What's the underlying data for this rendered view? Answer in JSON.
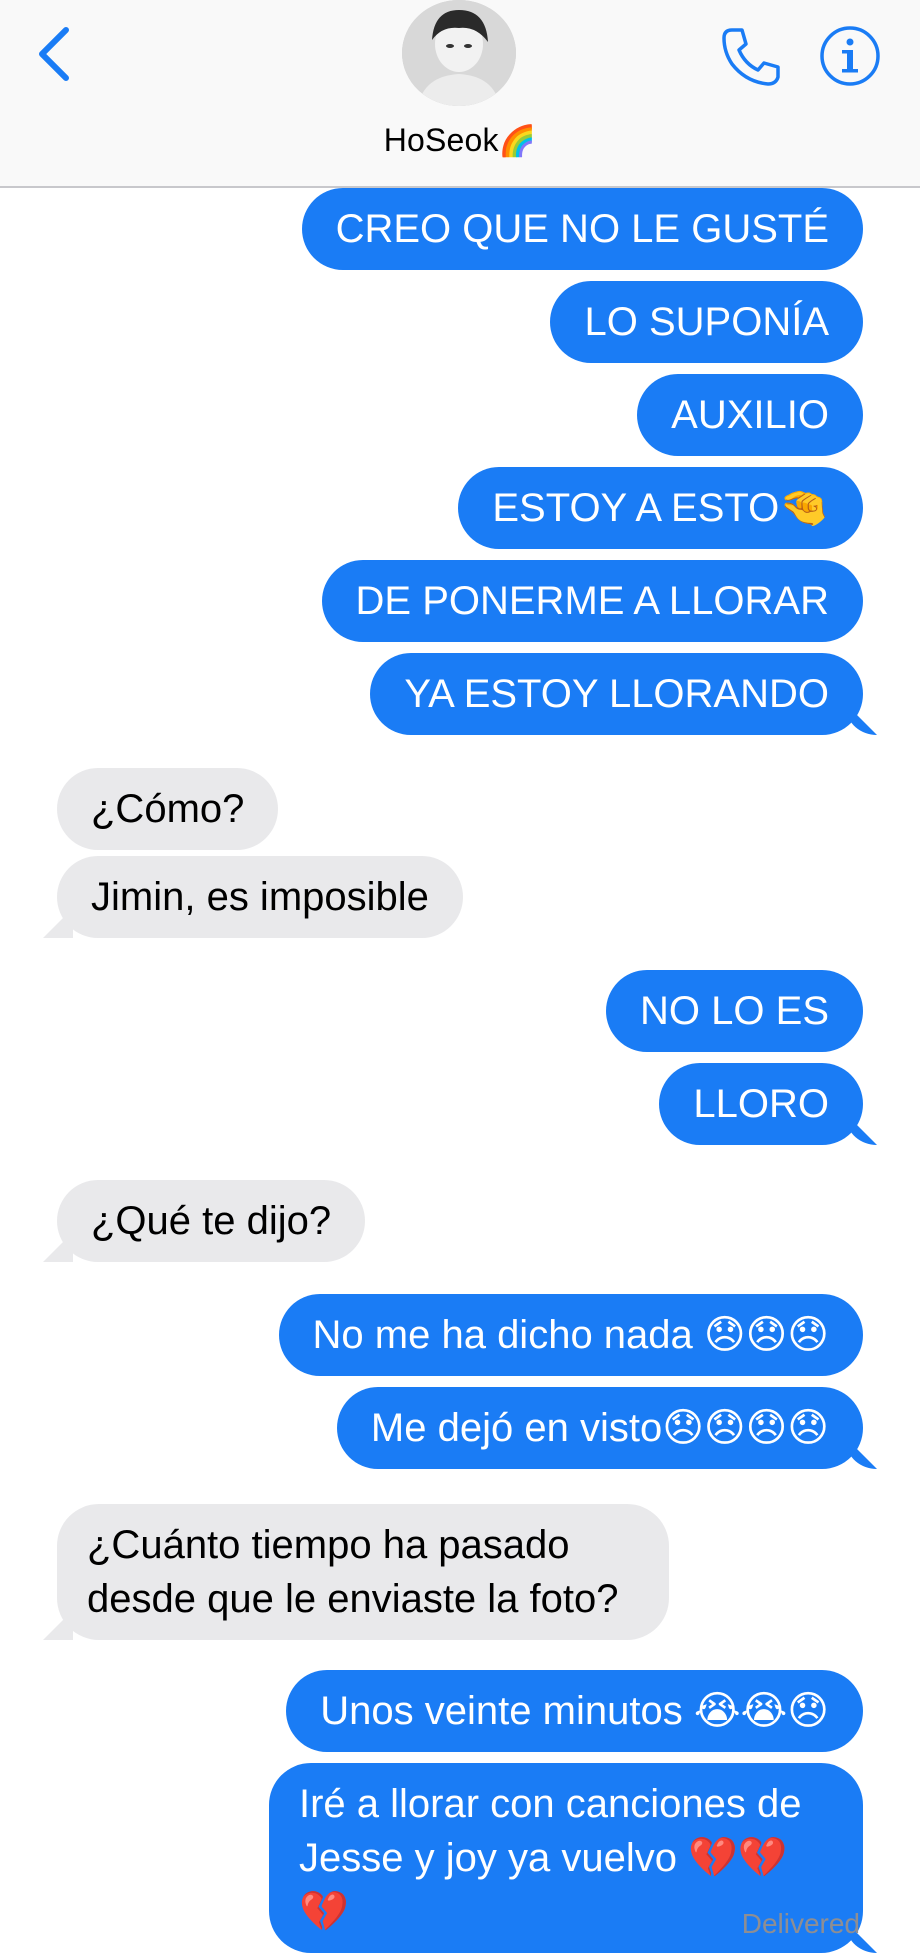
{
  "header": {
    "contact_name": "HoSeok",
    "name_emoji": "🌈",
    "back_icon": "chevron-left-icon",
    "phone_icon": "phone-icon",
    "info_icon": "info-icon",
    "accent_color": "#1a7cf5"
  },
  "messages": [
    {
      "dir": "out",
      "text": "CREO QUE NO LE GUSTÉ"
    },
    {
      "dir": "out",
      "text": "LO SUPONÍA"
    },
    {
      "dir": "out",
      "text": "AUXILIO"
    },
    {
      "dir": "out",
      "text": "ESTOY A ESTO🤏"
    },
    {
      "dir": "out",
      "text": "DE PONERME A LLORAR"
    },
    {
      "dir": "out",
      "text": "YA ESTOY LLORANDO"
    },
    {
      "dir": "in",
      "text": "¿Cómo?"
    },
    {
      "dir": "in",
      "text": "Jimin, es imposible"
    },
    {
      "dir": "out",
      "text": "NO LO ES"
    },
    {
      "dir": "out",
      "text": "LLORO"
    },
    {
      "dir": "in",
      "text": "¿Qué te dijo?"
    },
    {
      "dir": "out",
      "text": "No me ha dicho nada 😞😞😞"
    },
    {
      "dir": "out",
      "text": "Me dejó en visto😞😞😞😞"
    },
    {
      "dir": "in",
      "text": "¿Cuánto tiempo ha pasado desde que le enviaste la foto?"
    },
    {
      "dir": "out",
      "text": "Unos veinte minutos 😭😭😞"
    },
    {
      "dir": "out",
      "text": "Iré a llorar con canciones de Jesse y joy ya vuelvo 💔💔💔"
    }
  ],
  "status": {
    "delivered": "Delivered"
  }
}
